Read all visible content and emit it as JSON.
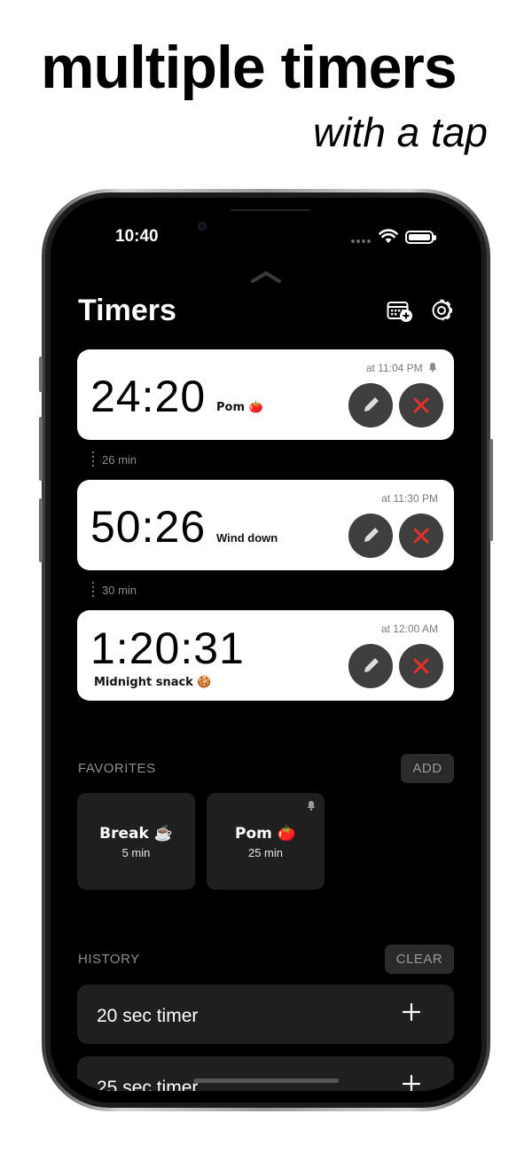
{
  "marketing": {
    "headline": "multiple timers",
    "subhead": "with a tap"
  },
  "status_bar": {
    "time": "10:40"
  },
  "header": {
    "title": "Timers",
    "calendar_icon": "calendar-add-icon",
    "settings_icon": "gear-icon"
  },
  "timers": [
    {
      "time": "24:20",
      "label": "Pom 🍅",
      "alarm": "at 11:04 PM",
      "has_bell": true
    },
    {
      "time": "50:26",
      "label": "Wind down",
      "alarm": "at 11:30 PM",
      "has_bell": false
    },
    {
      "time": "1:20:31",
      "label": "Midnight snack 🍪",
      "alarm": "at 12:00 AM",
      "has_bell": false
    }
  ],
  "gaps": [
    "26 min",
    "30 min"
  ],
  "favorites": {
    "title": "FAVORITES",
    "add_label": "ADD",
    "items": [
      {
        "name": "Break ☕️",
        "duration": "5 min",
        "has_bell": false
      },
      {
        "name": "Pom 🍅",
        "duration": "25 min",
        "has_bell": true
      }
    ]
  },
  "history": {
    "title": "HISTORY",
    "clear_label": "CLEAR",
    "items": [
      {
        "label": "20 sec timer"
      },
      {
        "label": "25 sec timer"
      }
    ]
  },
  "colors": {
    "background": "#000000",
    "card": "#ffffff",
    "delete_accent": "#e5302b",
    "dark_surface": "#1f1f1f"
  }
}
